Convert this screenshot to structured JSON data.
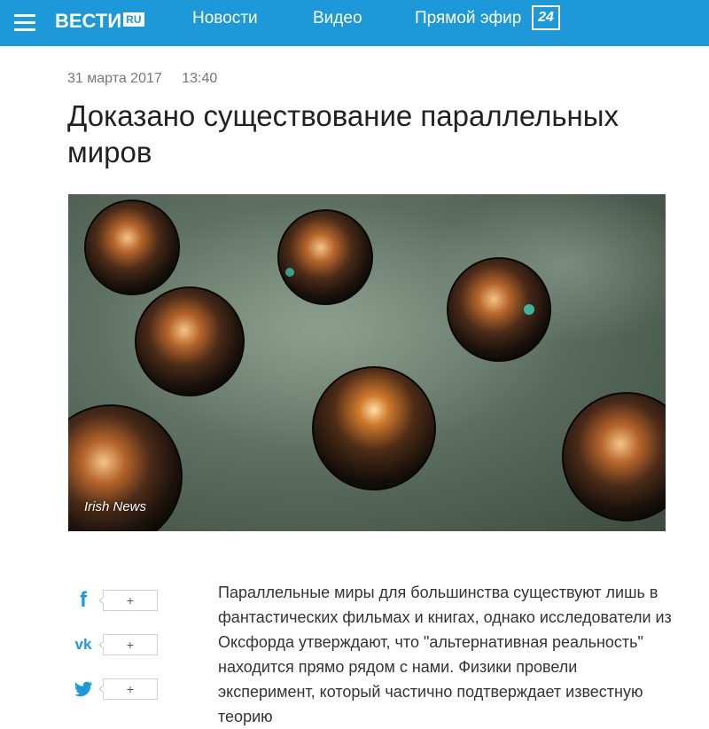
{
  "header": {
    "logo_main": "ВЕСТИ",
    "logo_suffix": "RU",
    "nav": {
      "news": "Новости",
      "video": "Видео",
      "live": "Прямой эфир",
      "live_badge": "24"
    }
  },
  "article": {
    "date": "31 марта 2017",
    "time": "13:40",
    "title": "Доказано существование параллельных миров",
    "photo_credit": "Irish News",
    "body": "Параллельные миры для большинства существуют лишь в фантастических фильмах и книгах, однако исследователи из Оксфорда утверждают, что \"альтернативная реальность\" находится прямо рядом с нами. Физики провели эксперимент, который частично подтверждает известную теорию"
  },
  "share": [
    {
      "network": "facebook",
      "icon": "facebook-icon",
      "count_label": "+"
    },
    {
      "network": "vkontakte",
      "icon": "vk-icon",
      "count_label": "+"
    },
    {
      "network": "twitter",
      "icon": "twitter-icon",
      "count_label": "+"
    }
  ],
  "colors": {
    "brand": "#1d98d8",
    "title": "#222222",
    "meta": "#777777"
  }
}
